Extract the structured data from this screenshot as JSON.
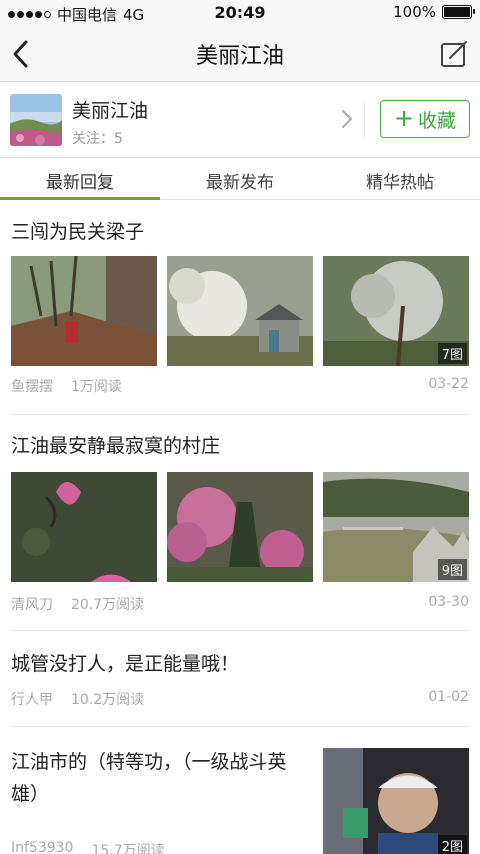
{
  "status_bar": {
    "carrier": "中国电信",
    "network": "4G",
    "time": "20:49",
    "battery": "100%",
    "battery_level": 1.0
  },
  "nav": {
    "title": "美丽江油"
  },
  "forum": {
    "name": "美丽江油",
    "followers": "关注：5",
    "collect_label": "收藏",
    "accent_color": "#4cb34b"
  },
  "tabs": [
    {
      "label": "最新回复",
      "active": true
    },
    {
      "label": "最新发布",
      "active": false
    },
    {
      "label": "精华热帖",
      "active": false
    }
  ],
  "posts": [
    {
      "title": "三闯为民关梁子",
      "author": "鱼摆摆",
      "reads": "1万阅读",
      "date": "03-22",
      "image_count": "7图"
    },
    {
      "title": "江油最安静最寂寞的村庄",
      "author": "清风刀",
      "reads": "20.7万阅读",
      "date": "03-30",
      "image_count": "9图"
    },
    {
      "title": "城管没打人，是正能量哦！",
      "author": "行人甲",
      "reads": "10.2万阅读",
      "date": "01-02"
    },
    {
      "title": "江油市的（特等功，（一级战斗英雄）",
      "author": "Inf53930",
      "reads": "15.7万阅读",
      "image_count": "2图"
    }
  ]
}
